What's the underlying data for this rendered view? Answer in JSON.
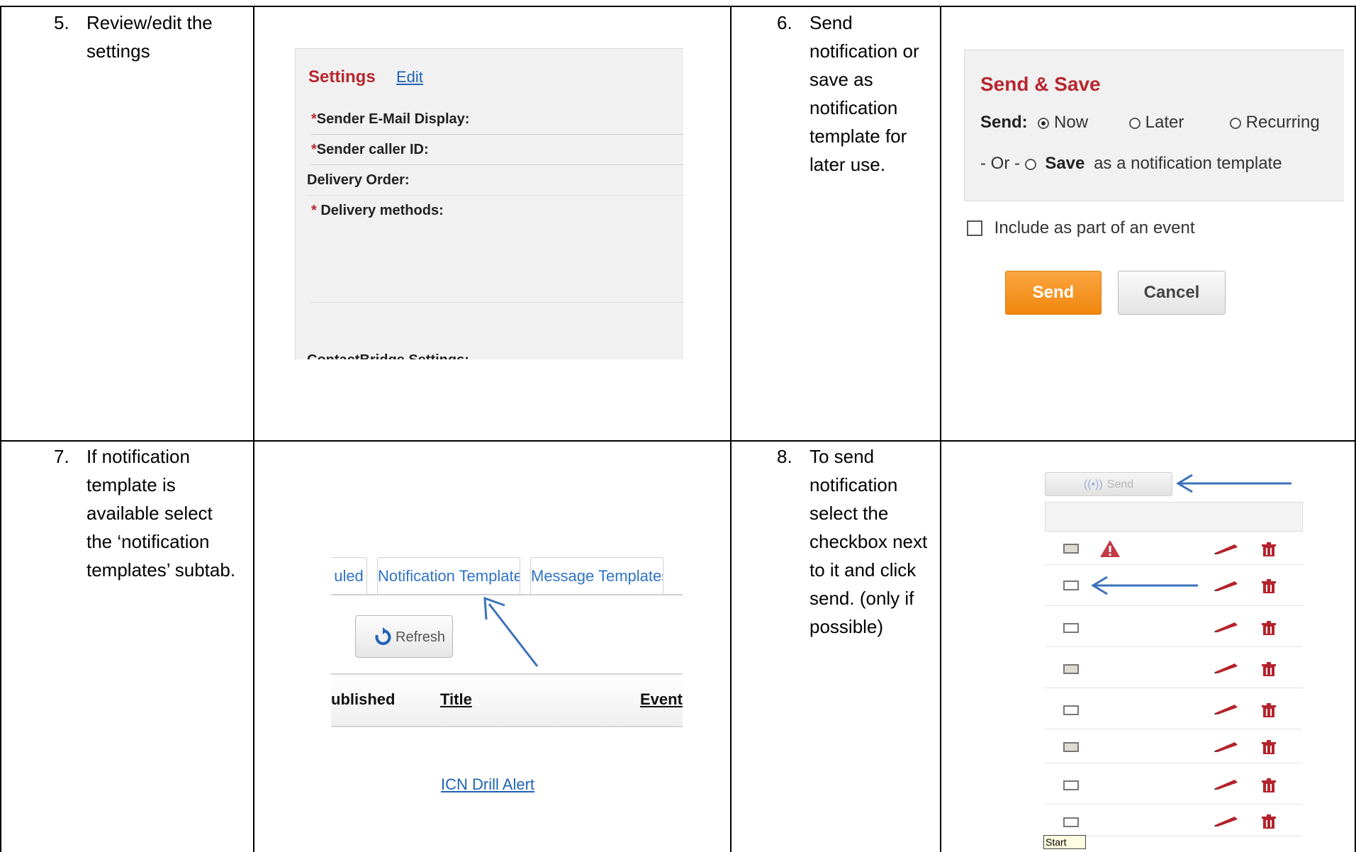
{
  "steps": [
    {
      "num": "5.",
      "lines": [
        "Review/edit the",
        "settings"
      ]
    },
    {
      "num": "6.",
      "lines": [
        "Send",
        "notification or",
        "save as",
        "notification",
        "template for",
        "later use."
      ]
    },
    {
      "num": "7.",
      "lines": [
        "If notification",
        "template is",
        "available select",
        "the ‘notification",
        "templates’ subtab."
      ]
    },
    {
      "num": "8.",
      "lines": [
        "To send",
        "notification",
        "select the",
        "checkbox next",
        "to it and click",
        "send. (only if",
        "possible)"
      ]
    }
  ],
  "settings": {
    "title": "Settings",
    "edit": "Edit",
    "rows": [
      {
        "req": "*",
        "label": "Sender E-Mail Display:"
      },
      {
        "req": "*",
        "label": "Sender caller ID:"
      },
      {
        "req": "",
        "label": "Delivery Order:"
      },
      {
        "req": "* ",
        "label": "Delivery methods:"
      },
      {
        "req": "",
        "label": "ContactBridge Settings:"
      }
    ]
  },
  "send_save": {
    "title": "Send & Save",
    "send_label": "Send:",
    "options": [
      "Now",
      "Later",
      "Recurring"
    ],
    "selected": "Now",
    "or_prefix": "- Or -",
    "save_label": "Save",
    "save_suffix": "as a notification template",
    "include_event": "Include as part of an event",
    "send_button": "Send",
    "cancel_button": "Cancel"
  },
  "templates_tab": {
    "tabs": [
      "uled",
      "Notification Templates",
      "Message Templates"
    ],
    "refresh": "Refresh",
    "columns": [
      "ublished",
      "Title",
      "Event N"
    ],
    "row_link": "ICN Drill Alert"
  },
  "send_list": {
    "send_button": "Send",
    "row_shaded": [
      true,
      false,
      false,
      true,
      false,
      true,
      false,
      false
    ],
    "warning_row": 0,
    "start_label": "Start"
  },
  "colors": {
    "accent_red": "#b8262f",
    "link_blue": "#1f63b6",
    "arrow_blue": "#3b72b8",
    "send_orange": "#f0860e"
  }
}
